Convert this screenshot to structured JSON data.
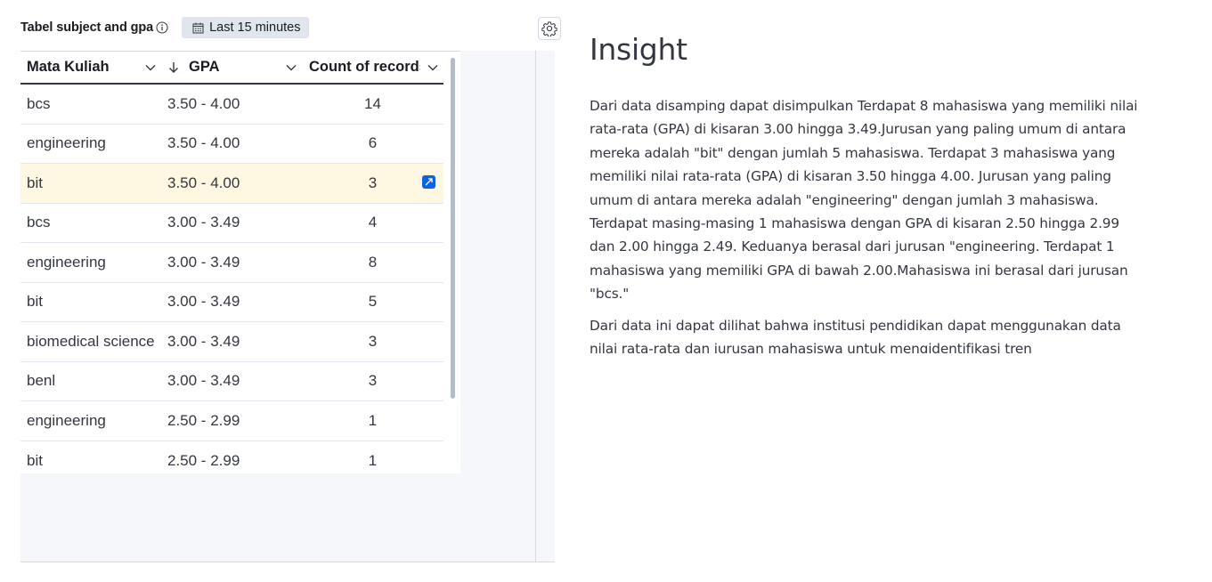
{
  "panel": {
    "title": "Tabel subject and gpa",
    "time_range": "Last 15 minutes"
  },
  "table": {
    "headers": [
      "Mata Kuliah",
      "GPA",
      "Count of records"
    ],
    "rows": [
      {
        "subject": "bcs",
        "gpa": "3.50 - 4.00",
        "count": "14"
      },
      {
        "subject": "engineering",
        "gpa": "3.50 - 4.00",
        "count": "6"
      },
      {
        "subject": "bit",
        "gpa": "3.50 - 4.00",
        "count": "3"
      },
      {
        "subject": "bcs",
        "gpa": "3.00 - 3.49",
        "count": "4"
      },
      {
        "subject": "engineering",
        "gpa": "3.00 - 3.49",
        "count": "8"
      },
      {
        "subject": "bit",
        "gpa": "3.00 - 3.49",
        "count": "5"
      },
      {
        "subject": "biomedical science",
        "gpa": "3.00 - 3.49",
        "count": "3"
      },
      {
        "subject": "benl",
        "gpa": "3.00 - 3.49",
        "count": "3"
      },
      {
        "subject": "engineering",
        "gpa": "2.50 - 2.99",
        "count": "1"
      },
      {
        "subject": "bit",
        "gpa": "2.50 - 2.99",
        "count": "1"
      }
    ],
    "highlighted_row": 2
  },
  "insight": {
    "title": "Insight",
    "paragraph1": "Dari data disamping dapat disimpulkan Terdapat 8 mahasiswa yang memiliki nilai rata-rata (GPA) di kisaran 3.00 hingga 3.49.Jurusan yang paling umum di antara mereka adalah \"bit\" dengan jumlah 5 mahasiswa. Terdapat 3 mahasiswa yang memiliki nilai rata-rata (GPA) di kisaran 3.50 hingga 4.00. Jurusan yang paling umum di antara mereka adalah \"engineering\" dengan jumlah 3 mahasiswa. Terdapat masing-masing 1 mahasiswa dengan GPA di kisaran 2.50 hingga 2.99 dan 2.00 hingga 2.49. Keduanya berasal dari jurusan \"engineering. Terdapat 1 mahasiswa yang memiliki GPA di bawah 2.00.Mahasiswa ini berasal dari jurusan \"bcs.\"",
    "paragraph2": "Dari data ini dapat dilihat bahwa institusi pendidikan dapat menggunakan data nilai rata-rata dan jurusan mahasiswa untuk mengidentifikasi tren"
  },
  "icons": {
    "info": "info-icon",
    "calendar": "calendar-icon",
    "settings": "gear-icon",
    "sort": "sort-descending-icon",
    "expand": "expand-cell-icon"
  }
}
